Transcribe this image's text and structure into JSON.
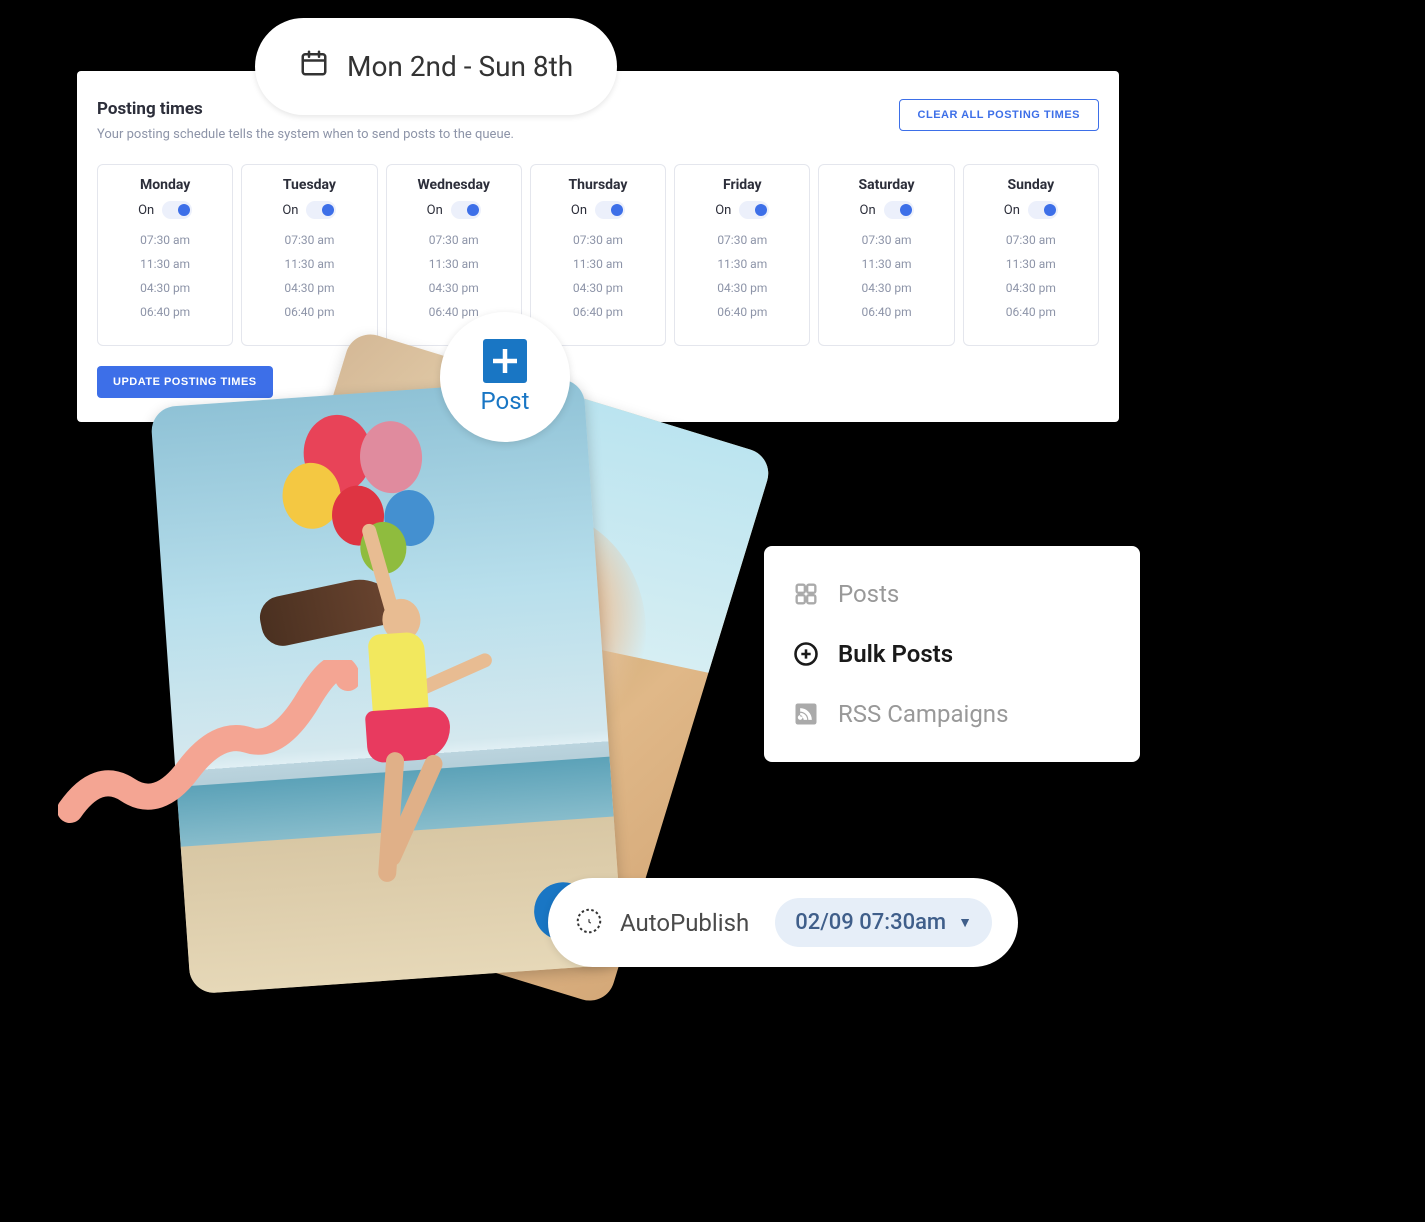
{
  "date_range": "Mon 2nd - Sun 8th",
  "posting_times": {
    "title": "Posting times",
    "subtitle": "Your posting schedule tells the system when to send posts to the queue.",
    "clear_label": "CLEAR ALL POSTING TIMES",
    "update_label": "UPDATE POSTING TIMES",
    "toggle_text": "On",
    "days": [
      {
        "name": "Monday",
        "times": [
          "07:30 am",
          "11:30 am",
          "04:30 pm",
          "06:40 pm"
        ]
      },
      {
        "name": "Tuesday",
        "times": [
          "07:30 am",
          "11:30 am",
          "04:30 pm",
          "06:40 pm"
        ]
      },
      {
        "name": "Wednesday",
        "times": [
          "07:30 am",
          "11:30 am",
          "04:30 pm",
          "06:40 pm"
        ]
      },
      {
        "name": "Thursday",
        "times": [
          "07:30 am",
          "11:30 am",
          "04:30 pm",
          "06:40 pm"
        ]
      },
      {
        "name": "Friday",
        "times": [
          "07:30 am",
          "11:30 am",
          "04:30 pm",
          "06:40 pm"
        ]
      },
      {
        "name": "Saturday",
        "times": [
          "07:30 am",
          "11:30 am",
          "04:30 pm",
          "06:40 pm"
        ]
      },
      {
        "name": "Sunday",
        "times": [
          "07:30 am",
          "11:30 am",
          "04:30 pm",
          "06:40 pm"
        ]
      }
    ]
  },
  "post_button": {
    "label": "Post"
  },
  "menu": {
    "items": [
      {
        "label": "Posts",
        "icon": "grid-icon",
        "active": false
      },
      {
        "label": "Bulk Posts",
        "icon": "plus-circle-icon",
        "active": true
      },
      {
        "label": "RSS Campaigns",
        "icon": "rss-icon",
        "active": false
      }
    ]
  },
  "autopublish": {
    "label": "AutoPublish",
    "time": "02/09 07:30am"
  },
  "media_icons": {
    "camera": "camera-icon",
    "video": "video-icon"
  },
  "colors": {
    "accent_blue": "#3d6fe8",
    "brand_blue": "#1976c4",
    "chip_bg": "#e6eef8",
    "chip_text": "#3f5e8a",
    "squiggle": "#f4a593"
  }
}
